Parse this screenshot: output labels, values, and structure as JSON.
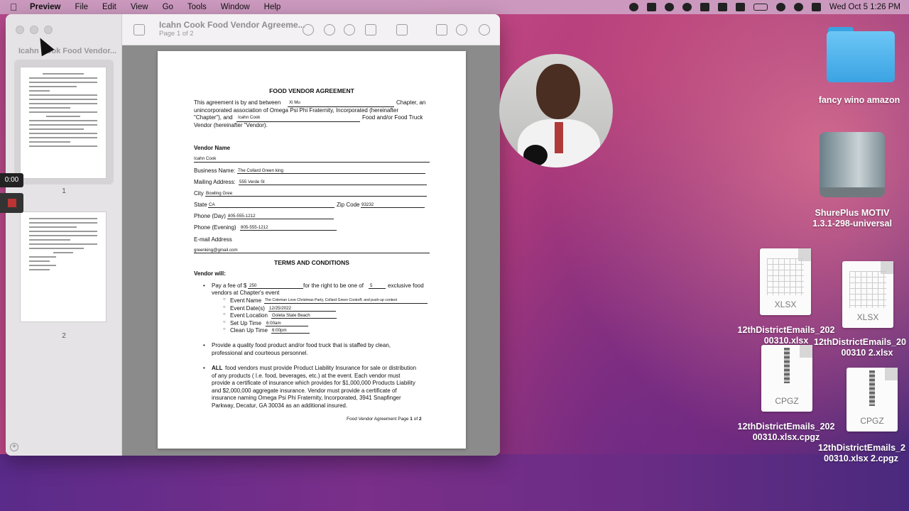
{
  "menubar": {
    "app": "Preview",
    "menus": [
      "File",
      "Edit",
      "View",
      "Go",
      "Tools",
      "Window",
      "Help"
    ],
    "clock": "Wed Oct 5  1:26 PM"
  },
  "window": {
    "sidebar_title": "Icahn Cook Food Vendor...",
    "title": "Icahn Cook Food Vendor Agreeme...",
    "subtitle": "Page 1 of 2",
    "page_labels": [
      "1",
      "2"
    ]
  },
  "recording": {
    "time": "0:00"
  },
  "document": {
    "title": "FOOD VENDOR AGREEMENT",
    "intro_1": "This agreement is by and between",
    "chapter_value": "Xi Mu",
    "intro_2": "Chapter, an",
    "intro_3": "unincorporated association of Omega Psi Phi Fraternity, Incorporated (hereinafter",
    "intro_4": "\"Chapter\"), and",
    "vendor_value": "Icahn Cook",
    "intro_5": "Food and/or Food Truck",
    "intro_6": "Vendor (hereinafter \"Vendor).",
    "vendor_name_label": "Vendor Name",
    "vendor_name": "Icahn Cook",
    "business_label": "Business Name:",
    "business": "The Collard Green king",
    "mailing_label": "Mailing Address:",
    "mailing": "555 Verde St",
    "city_label": "City",
    "city": "Bowling Gree",
    "state_label": "State",
    "state": "CA",
    "zip_label": "Zip Code",
    "zip": "93232",
    "phone_day_label": "Phone (Day)",
    "phone_day": "805-555-1212",
    "phone_eve_label": "Phone (Evening)",
    "phone_eve": "805-555-1212",
    "email_label": "E-mail Address",
    "email": "greenking@gmail.com",
    "terms_title": "TERMS AND CONDITIONS",
    "vendor_will": "Vendor will:",
    "fee_1": "Pay a fee of $",
    "fee_value": "250",
    "fee_2": "for the right to be one of",
    "count_value": "5",
    "fee_3": "exclusive food",
    "fee_4": "vendors at Chapter's event",
    "event_name_label": "Event Name",
    "event_name": "The Coleman Love Christmas Party, Collard Green Cookoff, and push-up contest",
    "event_dates_label": "Event Date(s)",
    "event_dates": "12/25/2022",
    "event_location_label": "Event Location",
    "event_location": "Goleta State Beach",
    "setup_label": "Set Up Time",
    "setup": "6:00am",
    "cleanup_label": "Clean Up Time",
    "cleanup": "6:00pm",
    "provide_1": "Provide a quality food product and/or food truck that is staffed by clean,",
    "provide_2": "professional and courteous personnel.",
    "all_bold": "ALL",
    "ins_1": "food vendors must provide Product Liability Insurance for sale or distribution",
    "ins_2": "of any products ( I.e. food, beverages, etc.) at the event. Each vendor must",
    "ins_3": "provide a certificate of insurance which provides for $1,000,000 Products Liability",
    "ins_4": "and $2,000,000 aggregate insurance.  Vendor must provide a certificate of",
    "ins_5": "insurance naming Omega Psi Phi Fraternity, Incorporated, 3941 Snapfinger",
    "ins_6": "Parkway, Decatur, GA  30034 as an additional insured.",
    "footer_text": "Food Vendor Agreement Page",
    "footer_page": "1",
    "footer_of": "of",
    "footer_total": "2"
  },
  "desktop": {
    "folder_label": "fancy wino  amazon",
    "drive_label_1": "ShurePlus MOTIV",
    "drive_label_2": "1.3.1-298-universal",
    "file1_type": "XLSX",
    "file1_label_1": "12thDistrictEmails_202",
    "file1_label_2": "00310.xlsx",
    "file2_type": "XLSX",
    "file2_label_1": "12thDistrictEmails_20",
    "file2_label_2": "00310 2.xlsx",
    "file3_type": "CPGZ",
    "file3_label_1": "12thDistrictEmails_202",
    "file3_label_2": "00310.xlsx.cpgz",
    "file4_type": "CPGZ",
    "file4_label_1": "12thDistrictEmails_2",
    "file4_label_2": "00310.xlsx 2.cpgz"
  }
}
